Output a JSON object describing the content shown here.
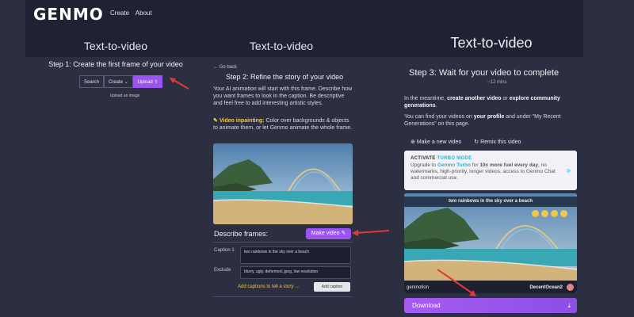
{
  "header": {
    "logo": "GENMO",
    "nav": [
      "Create",
      "About"
    ]
  },
  "panel1": {
    "title": "Text-to-video",
    "step": "Step 1: Create the first frame of your video",
    "buttons": {
      "search": "Search",
      "create": "Create",
      "upload": "Upload"
    },
    "upload_image": "Upload an image"
  },
  "panel2": {
    "title": "Text-to-video",
    "go_back": "← Go back",
    "step": "Step 2: Refine the story of your video",
    "description": "Your AI animation will start with this frame. Describe how you want frames to look in the caption. Be descriptive and feel free to add interesting artistic styles.",
    "inpainting_label": "Video inpainting:",
    "inpainting_text": "Color over backgrounds & objects to animate them, or let Genmo animate the whole frame.",
    "describe_frames": "Describe frames:",
    "make_video": "Make video",
    "caption_label": "Caption 1",
    "caption_value": "two rainbows in the sky over a beach",
    "exclude_label": "Exclude",
    "exclude_value": "blurry, ugly, deformed, jpeg, low resolution",
    "add_captions_link": "Add captions to tell a story →",
    "add_caption_button": "Add caption"
  },
  "panel3": {
    "title": "Text-to-video",
    "step": "Step 3: Wait for your video to complete",
    "eta": "~12 mins",
    "p1_pre": "In the meantime, ",
    "p1_link1": "create another video",
    "p1_mid": " or ",
    "p1_link2": "explore community generations",
    "p1_end": ".",
    "p2_pre": "You can find your videos on ",
    "p2_bold": "your profile",
    "p2_end": " and under \"My Recent Generations\" on this page.",
    "make_new_video": "Make a new video",
    "remix_video": "Remix this video",
    "turbo_activate": "ACTIVATE",
    "turbo_mode": "TURBO MODE",
    "turbo_pre": "Upgrade to ",
    "turbo_name": "Genmo Turbo",
    "turbo_mid": " for ",
    "turbo_fuel": "10x more fuel every day",
    "turbo_end": ", no watermarks, high-priority, longer videos, access to Genmo Chat and commercial use.",
    "video_caption": "two rainbows in the sky over a beach",
    "brand": "genmotion",
    "username": "DecentOcean2",
    "download": "Download"
  }
}
